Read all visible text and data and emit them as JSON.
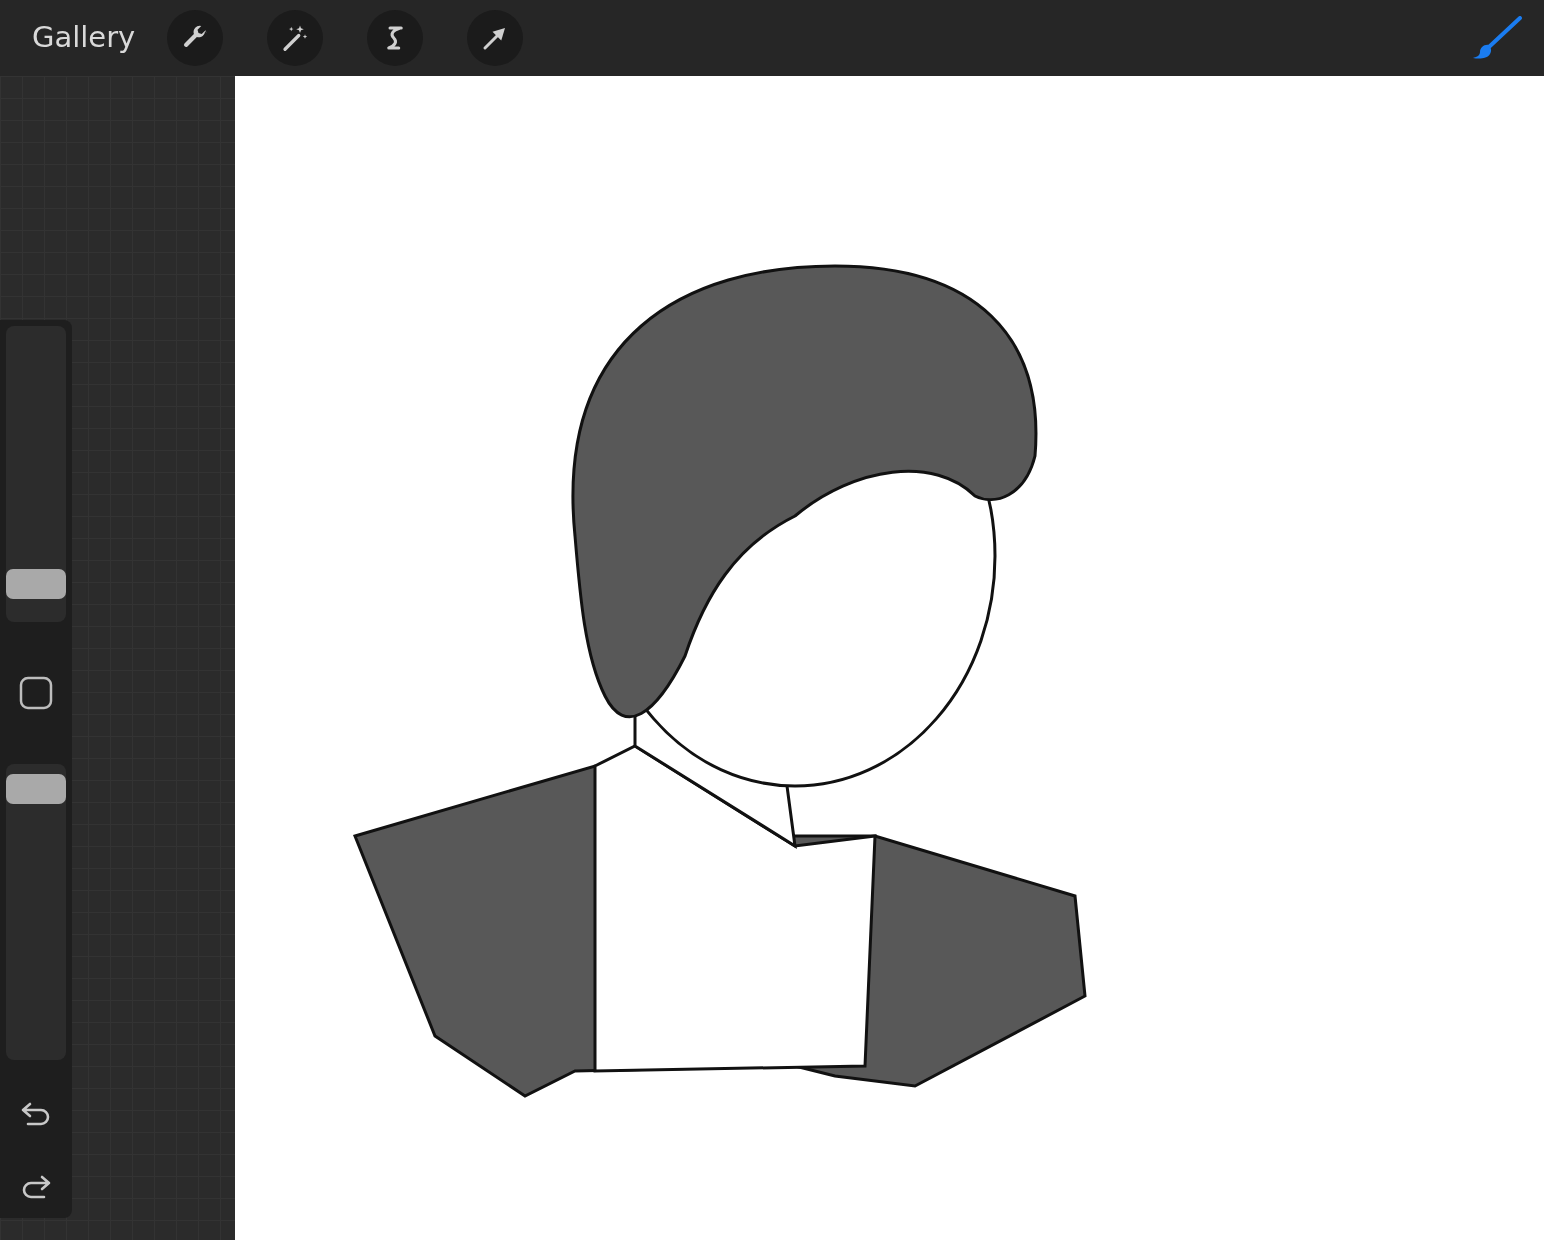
{
  "top_bar": {
    "gallery_label": "Gallery"
  },
  "sidebar": {
    "size_slider": {
      "level": 0.08
    },
    "opacity_slider": {
      "level": 0.97
    }
  }
}
